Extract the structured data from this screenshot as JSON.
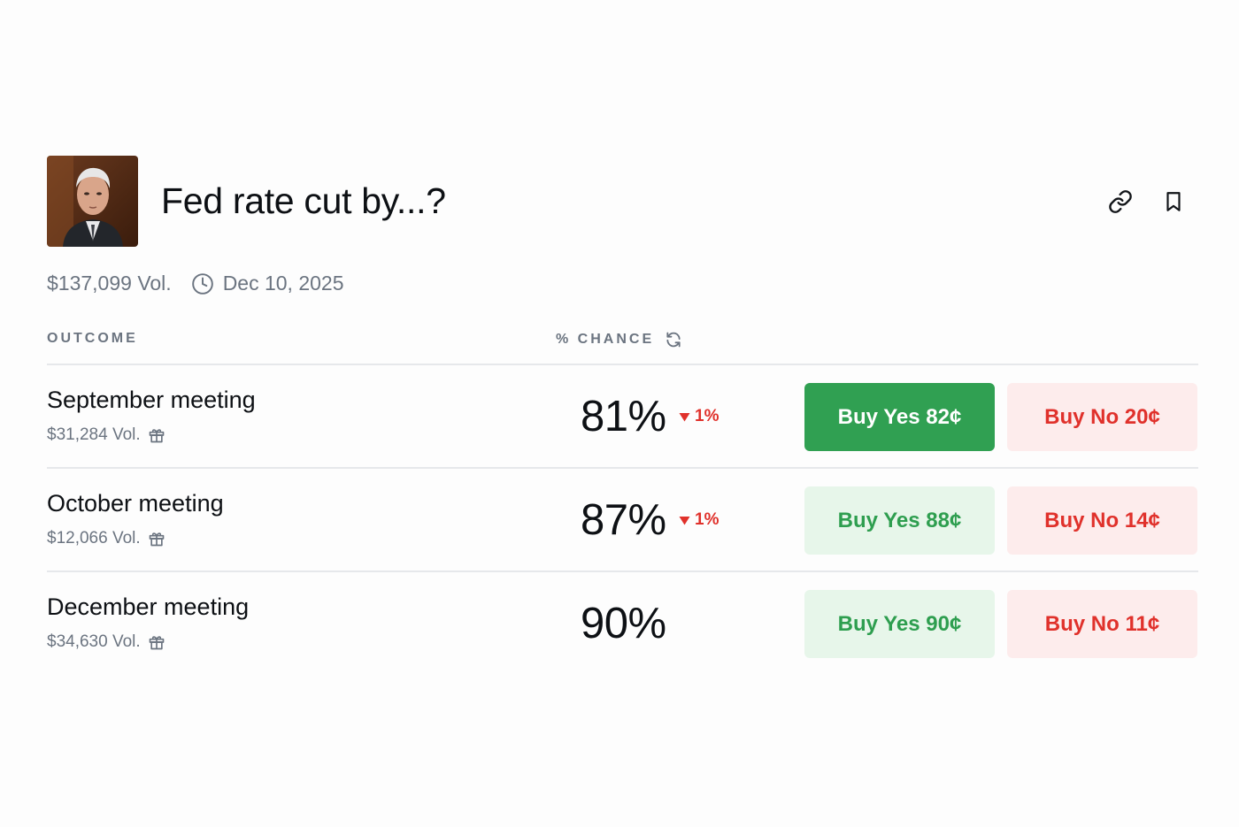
{
  "market": {
    "title": "Fed rate cut by...?",
    "volume": "$137,099 Vol.",
    "end_date": "Dec 10, 2025"
  },
  "table": {
    "outcome_header": "OUTCOME",
    "chance_header": "% CHANCE",
    "rows": [
      {
        "name": "September meeting",
        "volume": "$31,284 Vol.",
        "chance": "81%",
        "delta": "1%",
        "delta_direction": "down",
        "yes_label": "Buy Yes 82¢",
        "no_label": "Buy No 20¢",
        "yes_selected": true
      },
      {
        "name": "October meeting",
        "volume": "$12,066 Vol.",
        "chance": "87%",
        "delta": "1%",
        "delta_direction": "down",
        "yes_label": "Buy Yes 88¢",
        "no_label": "Buy No 14¢",
        "yes_selected": false
      },
      {
        "name": "December meeting",
        "volume": "$34,630 Vol.",
        "chance": "90%",
        "delta": "",
        "delta_direction": "",
        "yes_label": "Buy Yes 90¢",
        "no_label": "Buy No 11¢",
        "yes_selected": false
      }
    ]
  },
  "icons": {
    "link": "link-icon",
    "bookmark": "bookmark-icon",
    "clock": "clock-icon",
    "refresh": "refresh-icon",
    "gift": "gift-icon",
    "delta_down": "triangle-down-icon"
  },
  "colors": {
    "yes_active_bg": "#30a052",
    "yes_bg": "#e7f6ea",
    "yes_text": "#2e9e4f",
    "no_bg": "#fdecec",
    "no_text": "#e0312b",
    "muted_text": "#6b7480"
  }
}
